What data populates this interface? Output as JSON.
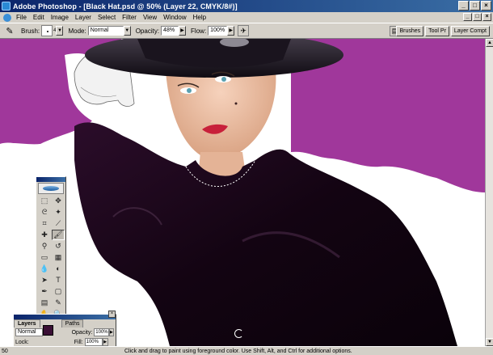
{
  "window": {
    "title": "Adobe Photoshop - [Black Hat.psd @ 50% (Layer 22, CMYK/8#)]",
    "minimize": "_",
    "maximize": "□",
    "close": "×"
  },
  "menu": {
    "items": [
      "File",
      "Edit",
      "Image",
      "Layer",
      "Select",
      "Filter",
      "View",
      "Window",
      "Help"
    ]
  },
  "options": {
    "brush_label": "Brush:",
    "brush_size": "4",
    "mode_label": "Mode:",
    "mode_value": "Normal",
    "opacity_label": "Opacity:",
    "opacity_value": "48%",
    "flow_label": "Flow:",
    "flow_value": "100%",
    "palette_tabs": [
      "Brushes",
      "Tool Pr",
      "Layer Compt"
    ]
  },
  "colors": {
    "foreground": "#3a0f35",
    "background": "#e6bdd0",
    "canvas_backdrop": "#a0379b"
  },
  "toolbox": {
    "tools": [
      {
        "icon": "marquee-icon",
        "glyph": "⬚"
      },
      {
        "icon": "move-icon",
        "glyph": "✥"
      },
      {
        "icon": "lasso-icon",
        "glyph": "ᘓ"
      },
      {
        "icon": "magic-wand-icon",
        "glyph": "✦"
      },
      {
        "icon": "crop-icon",
        "glyph": "⌗"
      },
      {
        "icon": "slice-icon",
        "glyph": "⟋"
      },
      {
        "icon": "healing-brush-icon",
        "glyph": "✚"
      },
      {
        "icon": "brush-icon",
        "glyph": "🖌",
        "active": true
      },
      {
        "icon": "clone-stamp-icon",
        "glyph": "⚲"
      },
      {
        "icon": "history-brush-icon",
        "glyph": "↺"
      },
      {
        "icon": "eraser-icon",
        "glyph": "▭"
      },
      {
        "icon": "gradient-icon",
        "glyph": "▦"
      },
      {
        "icon": "blur-icon",
        "glyph": "💧"
      },
      {
        "icon": "dodge-icon",
        "glyph": "◐"
      },
      {
        "icon": "path-selection-icon",
        "glyph": "➤"
      },
      {
        "icon": "type-icon",
        "glyph": "T"
      },
      {
        "icon": "pen-icon",
        "glyph": "✒"
      },
      {
        "icon": "shape-icon",
        "glyph": "▢"
      },
      {
        "icon": "notes-icon",
        "glyph": "▤"
      },
      {
        "icon": "eyedropper-icon",
        "glyph": "✎"
      },
      {
        "icon": "hand-icon",
        "glyph": "✋"
      },
      {
        "icon": "zoom-icon",
        "glyph": "🔍"
      }
    ]
  },
  "layers_panel": {
    "tabs": [
      "Layers",
      "Paths"
    ],
    "blend_mode": "Normal",
    "opacity_label": "Opacity:",
    "opacity_value": "100%",
    "lock_label": "Lock:",
    "fill_label": "Fill:",
    "fill_value": "100%"
  },
  "status": {
    "zoom": "50",
    "message": "Click and drag to paint using foreground color. Use Shift, Alt, and Ctrl for additional options."
  }
}
